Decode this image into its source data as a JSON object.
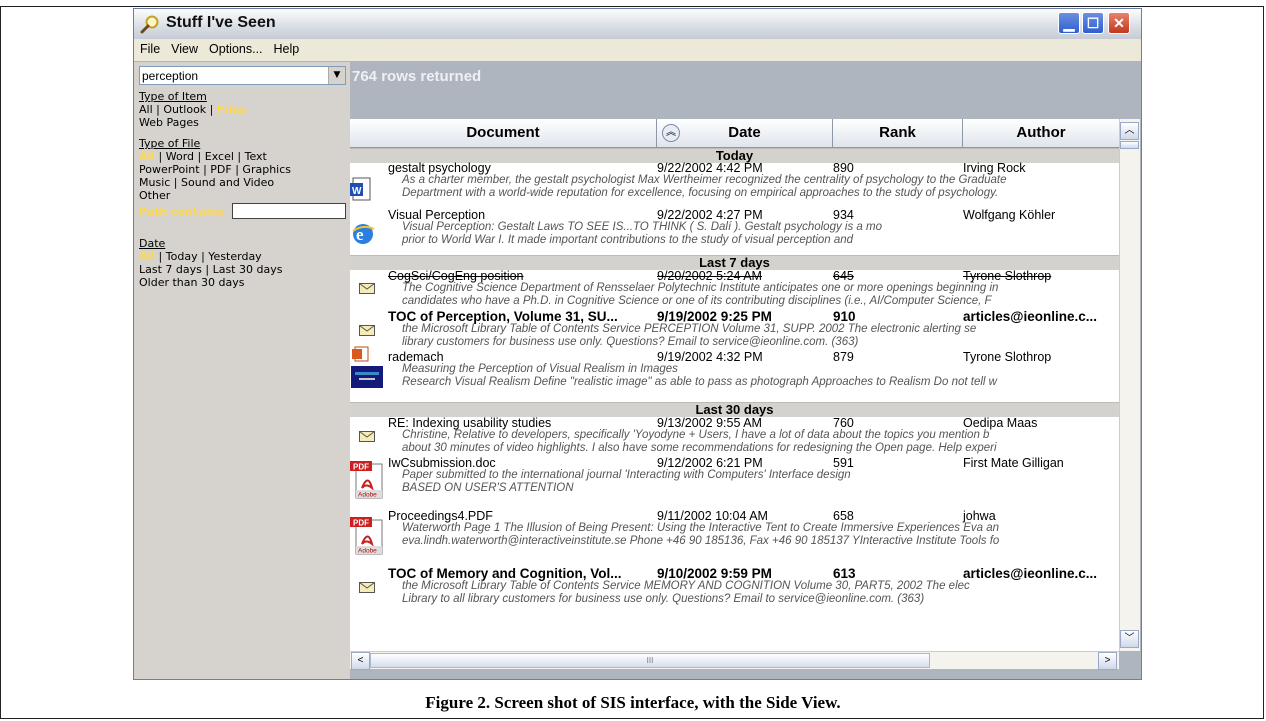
{
  "window": {
    "title": "Stuff I've Seen"
  },
  "menu": [
    "File",
    "View",
    "Options...",
    "Help"
  ],
  "sidebar": {
    "search_value": "perception",
    "type_item_heading": "Type of Item",
    "type_item_all": "All",
    "type_item_outlook": "Outlook",
    "type_item_files": "Files",
    "type_item_web": "Web Pages",
    "type_file_heading": "Type of File",
    "type_file_all": "All",
    "type_file_word": "Word",
    "type_file_excel": "Excel",
    "type_file_text": "Text",
    "type_file_powerpoint": "PowerPoint",
    "type_file_pdf": "PDF",
    "type_file_graphics": "Graphics",
    "type_file_music": "Music",
    "type_file_sound": "Sound and Video",
    "type_file_other": "Other",
    "path_label": "Path contains",
    "path_value": "",
    "date_heading": "Date",
    "date_all": "All",
    "date_today": "Today",
    "date_yesterday": "Yesterday",
    "date_7": "Last 7 days",
    "date_30": "Last 30 days",
    "date_older": "Older than 30 days"
  },
  "results": {
    "count": "764 rows returned",
    "columns": [
      "Document",
      "Date",
      "Rank",
      "Author"
    ]
  },
  "groups": [
    "Today",
    "Last 7 days",
    "Last 30 days"
  ],
  "items": [
    {
      "icon": "word-doc-icon",
      "doc": "gestalt psychology",
      "date": "9/22/2002 4:42 PM",
      "rank": "890",
      "author": "Irving Rock",
      "s1": "As a charter member, the gestalt psychologist Max Wertheimer recognized the centrality of psychology to the Graduate",
      "s2": "Department with a world-wide reputation for excellence, focusing on empirical approaches to the study of psychology."
    },
    {
      "icon": "web-page-icon",
      "doc": "Visual Perception",
      "date": "9/22/2002 4:27 PM",
      "rank": "934",
      "author": "Wolfgang Köhler",
      "s1": "Visual        Perception: Gestalt Laws TO SEE IS...TO THINK ( S.          Dalí ). Gestalt psychology          is a mo",
      "s2": "prior to World              War I. It made important contributions to the study of visual perception            and"
    },
    {
      "icon": "email-icon",
      "doc": "CogSci/CogEng position",
      "date": "9/20/2002 5:24 AM",
      "rank": "645",
      "author": "Tyrone Slothrop",
      "s1": "The Cognitive Science Department of Rensselaer Polytechnic Institute  anticipates one or more openings beginning in",
      "s2": "candidates who have a Ph.D. in Cognitive Science or  one of its contributing disciplines (i.e., AI/Computer Science,  F"
    },
    {
      "icon": "email-icon",
      "doc": "TOC of Perception, Volume 31, SU...",
      "date": "9/19/2002 9:25 PM",
      "rank": "910",
      "author": "articles@ieonline.c...",
      "s1": "the Microsoft Library Table of Contents Service    PERCEPTION  Volume 31, SUPP. 2002    The electronic alerting se",
      "s2": "library customers for business use only.   Questions? Email to service@ieonline.com. (363)"
    },
    {
      "icon": "powerpoint-icon",
      "doc": "rademach",
      "date": "9/19/2002 4:32 PM",
      "rank": "879",
      "author": "Tyrone Slothrop",
      "s1": "Measuring the Perception of Visual Realism in Images",
      "s2": "Research Visual Realism Define \"realistic image\" as able to pass as photograph   Approaches to Realism Do not tell w"
    },
    {
      "icon": "email-icon",
      "doc": "RE: Indexing usability studies",
      "date": "9/13/2002 9:55 AM",
      "rank": "760",
      "author": "Oedipa Maas",
      "s1": "Christine,     Relative to developers, specifically 'Yoyodyne + Users, I have a lot of data about the topics you mention b",
      "s2": "about 30 minutes of video highlights. I also have some recommendations for redesigning the Open page.  Help experi"
    },
    {
      "icon": "pdf-icon",
      "doc": "IwCsubmission.doc",
      "date": "9/12/2002 6:21 PM",
      "rank": "591",
      "author": "First Mate Gilligan",
      "s1": "Paper submitted to the international journal 'Interacting with Computers'                                   Interface design",
      "s2": "BASED ON USER'S ATTENTION"
    },
    {
      "icon": "pdf-icon",
      "doc": "Proceedings4.PDF",
      "date": "9/11/2002 10:04 AM",
      "rank": "658",
      "author": "johwa",
      "s1": "Waterworth Page 1 The Illusion of Being Present: Using the Interactive Tent to Create Immersive Experiences Eva an",
      "s2": "eva.lindh.waterworth@interactiveinstitute.se Phone +46 90 185136, Fax +46 90 185137 YInteractive Institute Tools fo"
    },
    {
      "icon": "email-icon",
      "doc": "TOC of Memory and Cognition, Vol...",
      "date": "9/10/2002 9:59 PM",
      "rank": "613",
      "author": "articles@ieonline.c...",
      "s1": "the Microsoft Library Table of Contents Service    MEMORY AND COGNITION  Volume 30, PART5, 2002    The elec",
      "s2": "Library to all library customers for business use only.   Questions? Email to service@ieonline.com. (363)"
    }
  ],
  "caption": "Figure 2. Screen shot of SIS interface, with the Side View."
}
